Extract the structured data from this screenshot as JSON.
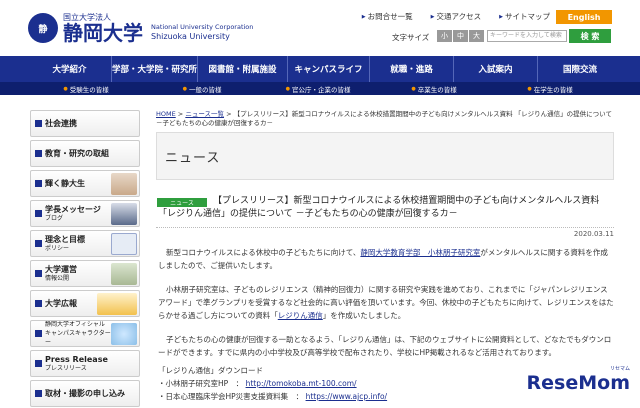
{
  "header": {
    "logo_mark": "静",
    "logo_small": "国立大学法人",
    "logo_big": "静岡大学",
    "logo_en_1": "National University Corporation",
    "logo_en_2": "Shizuoka University",
    "toplinks": [
      "お問合せ一覧",
      "交通アクセス",
      "サイトマップ"
    ],
    "english": "English",
    "font_size_label": "文字サイズ",
    "font_sizes": [
      "小",
      "中",
      "大"
    ],
    "search_placeholder": "キーワードを入力して検索",
    "search_button": "検 索",
    "accent_color": "#1b2f8f",
    "english_color": "#f29600",
    "search_color": "#2f9e3e"
  },
  "nav": {
    "items": [
      "大学紹介",
      "学部・大学院・研究所",
      "図書館・附属施設",
      "キャンパスライフ",
      "就職・進路",
      "入試案内",
      "国際交流"
    ],
    "sub_items": [
      "受験生の皆様",
      "一般の皆様",
      "官公庁・企業の皆様",
      "卒業生の皆様",
      "在学生の皆様"
    ]
  },
  "sidebar": {
    "items": [
      {
        "label": "社会連携",
        "small": ""
      },
      {
        "label": "教育・研究の取組",
        "small": ""
      },
      {
        "label": "輝く静大生",
        "small": ""
      },
      {
        "label": "学長メッセージ",
        "small": "ブログ"
      },
      {
        "label": "理念と目標",
        "small": "ポリシー"
      },
      {
        "label": "大学運営",
        "small": "情報公開"
      },
      {
        "label": "大学広報",
        "small": ""
      },
      {
        "label": "静岡大学オフィシャル",
        "small": "キャンパスキャラクター しずっぴー"
      },
      {
        "label": "Press Release",
        "small": "プレスリリース"
      },
      {
        "label": "取材・撮影の申し込み",
        "small": ""
      }
    ]
  },
  "breadcrumb": {
    "home": "HOME",
    "sep1": " > ",
    "news": "ニュース一覧",
    "sep2": " > ",
    "current": "【プレスリリース】新型コロナウイルスによる休校措置期間中の子ども向けメンタルヘルス資料 「レジりん通信」の提供について －子どもたちの心の健康が回復するカ－"
  },
  "page_heading": "ニュース",
  "article": {
    "tag": "ニュース",
    "title": "【プレスリリース】新型コロナウイルスによる休校措置期間中の子ども向けメンタルヘルス資料 「レジりん通信」の提供について －子どもたちの心の健康が回復するカ－",
    "date": "2020.03.11",
    "p1_a": "新型コロナウイルスによる休校中の子どもたちに向けて、",
    "p1_link": "静岡大学教育学部　小林朋子研究室",
    "p1_b": "がメンタルヘルスに関する資料を作成しましたので、ご提供いたします。",
    "p2_a": "小林朋子研究室は、子どものレジリエンス（精神的回復力）に関する研究や実践を進めており、これまでに「ジャパンレジリエンスアワード」で準グランプリを受賞するなど社会的に高い評価を頂いています。今回、休校中の子どもたちに向けて、レジリエンスをはたらかせる過ごし方についての資料「",
    "p2_link": "レジりん通信",
    "p2_b": "」を作成いたしました。",
    "p3": "子どもたちの心の健康が回復する一助となるよう、「レジりん通信」は、下記のウェブサイトに公開資料として、どなたでもダウンロードができます。すでに県内の小中学校及び高等学校で配布されたり、学校にHP掲載されるなど活用されております。",
    "dl_title": "「レジりん通信」ダウンロード",
    "dl_1_label": "・小林朋子研究室HP　：",
    "dl_1_url": "http://tomokoba.mt-100.com/",
    "dl_2_label": "・日本心理臨床学会HP災害支援資料集　：",
    "dl_2_url": "https://www.ajcp.info/"
  },
  "watermark": {
    "text": "ReseMom",
    "sub": "リセマム"
  }
}
